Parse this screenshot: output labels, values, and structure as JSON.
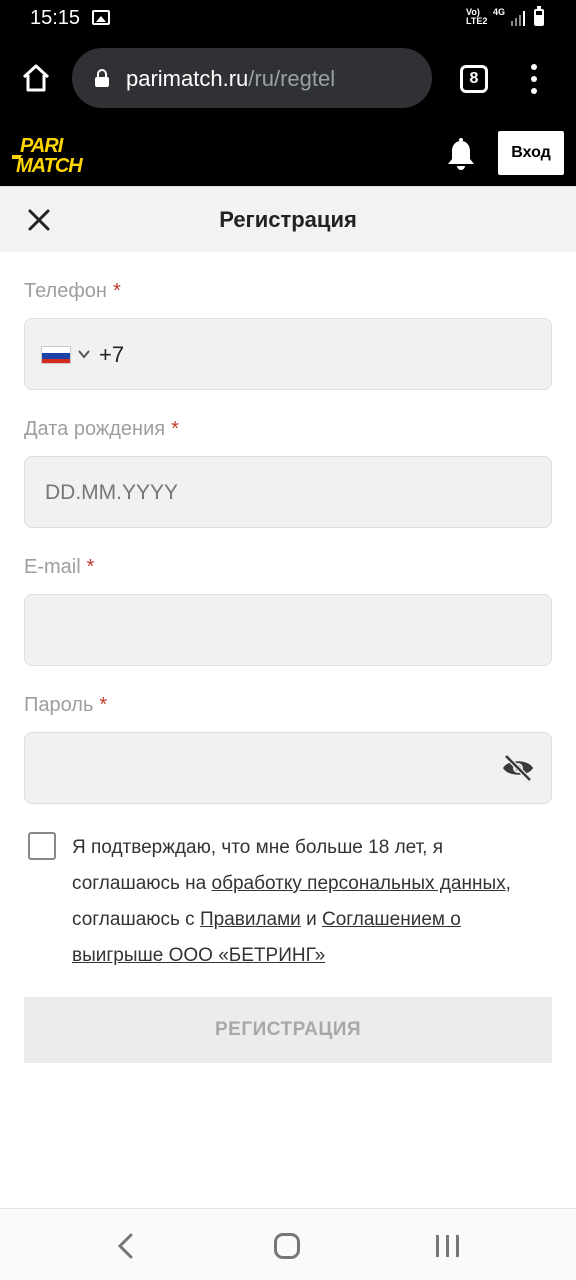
{
  "status_bar": {
    "time": "15:15",
    "network": "Vo) LTE2",
    "network_type": "4G",
    "icons": [
      "image-icon",
      "signal-icon",
      "battery-icon"
    ]
  },
  "browser": {
    "url_host": "parimatch.ru",
    "url_path": "/ru/regtel",
    "tab_count": "8",
    "icons": [
      "home-icon",
      "lock-icon",
      "menu-icon"
    ]
  },
  "site_header": {
    "logo_line1": "PARI",
    "logo_line2": "MATCH",
    "login_label": "Вход",
    "brand_color": "#ffd600"
  },
  "page": {
    "title": "Регистрация"
  },
  "form": {
    "phone": {
      "label": "Телефон",
      "required_mark": "*",
      "prefix": "+7",
      "country": "Russia"
    },
    "birthdate": {
      "label": "Дата рождения",
      "required_mark": "*",
      "placeholder": "DD.MM.YYYY"
    },
    "email": {
      "label": "E-mail",
      "required_mark": "*",
      "value": ""
    },
    "password": {
      "label": "Пароль",
      "required_mark": "*",
      "value": ""
    },
    "consent": {
      "checked": false,
      "text_1": "Я подтверждаю, что мне больше 18 лет, я соглашаюсь на ",
      "link_personal_data": "обработку персональных данных",
      "text_2": ", соглашаюсь с ",
      "link_rules": "Правилами",
      "text_3": " и ",
      "link_agreement": "Соглашением о выигрыше ООО «БЕТРИНГ»"
    },
    "submit_label": "РЕГИСТРАЦИЯ"
  }
}
